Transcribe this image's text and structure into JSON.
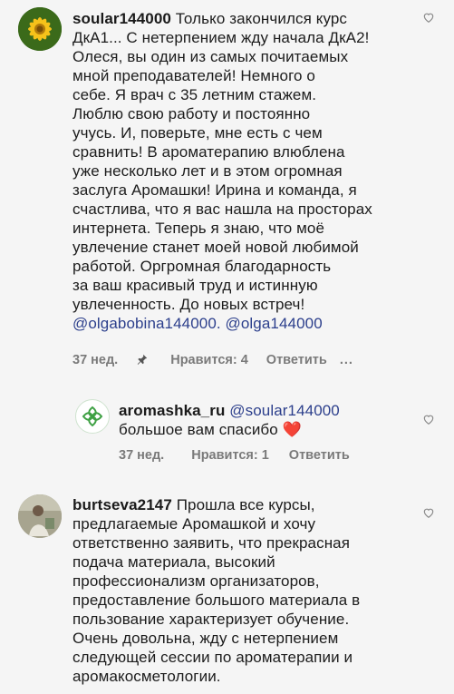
{
  "comments": [
    {
      "username": "soular144000",
      "lines": [
        " Только закончился курс",
        "ДкА1... С нетерпением жду начала ДкА2!",
        "Олеся, вы один из самых почитаемых",
        "мной преподавателей! Немного о",
        "себе. Я врач с 35 летним стажем.",
        "Люблю свою работу и постоянно",
        "учусь. И, поверьте, мне есть с чем",
        "сравнить! В ароматерапию влюблена",
        "уже несколько лет и в этом огромная",
        "заслуга Аромашки! Ирина и команда, я",
        "счастлива, что я вас нашла на просторах",
        "интернета. Теперь я знаю, что моё",
        "увлечение станет моей новой любимой",
        "работой. Оргромная благодарность",
        "за ваш красивый труд и истинную",
        "увлеченность. До новых встреч!"
      ],
      "mentions": "@olgabobina144000. @olga144000",
      "time": "37 нед.",
      "likes": "Нравится: 4",
      "reply": "Ответить",
      "more": "..."
    },
    {
      "username": "aromashka_ru",
      "mention": "@soular144000",
      "line2": "большое вам спасибо",
      "emoji": "❤️",
      "time": "37 нед.",
      "likes": "Нравится: 1",
      "reply": "Ответить"
    },
    {
      "username": "burtseva2147",
      "lines": [
        " Прошла все курсы,",
        "предлагаемые Аромашкой и хочу",
        "ответственно заявить, что прекрасная",
        "подача материала, высокий",
        "профессионализм организаторов,",
        "предоставление большого материала в",
        "пользование характеризует обучение.",
        "Очень довольна, жду с нетерпением",
        "следующей сессии по ароматерапии и",
        "аромакосметологии."
      ]
    }
  ],
  "colors": {
    "heart_red": "#e8272e",
    "mention": "#2c3f8c",
    "meta": "#7a7a7a"
  }
}
